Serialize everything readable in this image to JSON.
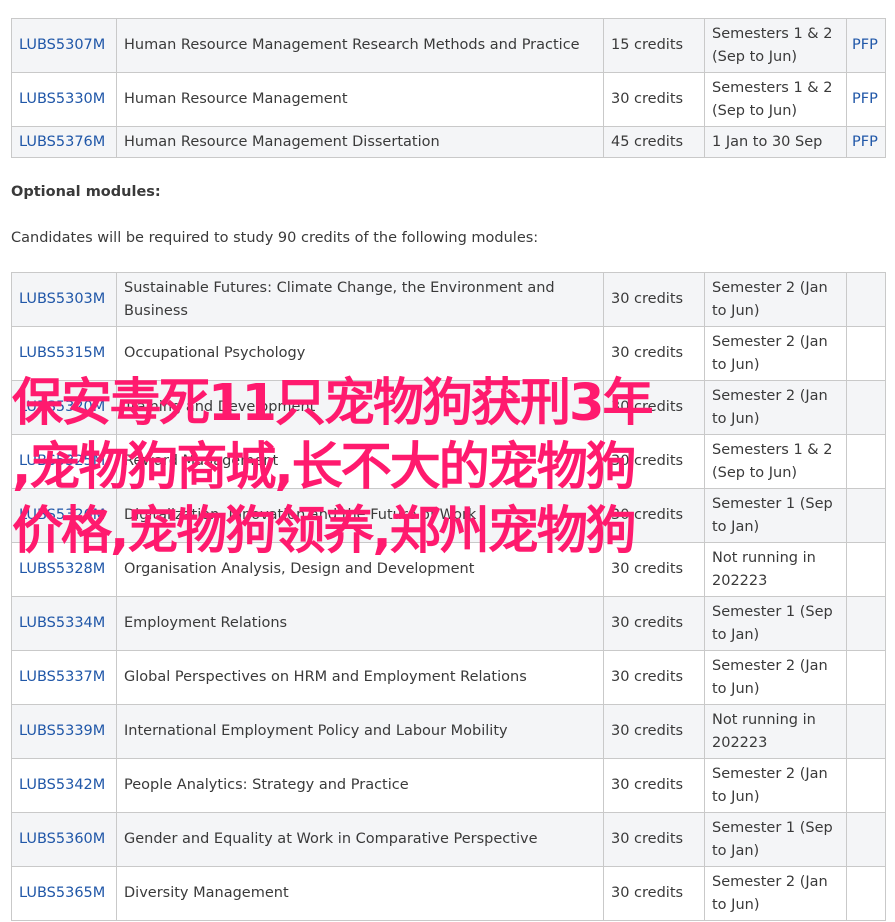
{
  "core_modules": [
    {
      "code": "LUBS5307M",
      "title": "Human Resource Management Research Methods and Practice",
      "credits": "15 credits",
      "running": "Semesters 1 & 2 (Sep to Jun)",
      "pfp": "PFP"
    },
    {
      "code": "LUBS5330M",
      "title": "Human Resource Management",
      "credits": "30 credits",
      "running": "Semesters 1 & 2 (Sep to Jun)",
      "pfp": "PFP"
    },
    {
      "code": "LUBS5376M",
      "title": "Human Resource Management Dissertation",
      "credits": "45 credits",
      "running": "1 Jan to 30 Sep",
      "pfp": "PFP"
    }
  ],
  "optional_section": {
    "heading": "Optional modules:",
    "intro": "Candidates will be required to study 90 credits of the following modules:"
  },
  "optional_modules": [
    {
      "code": "LUBS5303M",
      "title": "Sustainable Futures: Climate Change, the Environment and Business",
      "credits": "30 credits",
      "running": "Semester 2 (Jan to Jun)"
    },
    {
      "code": "LUBS5315M",
      "title": "Occupational Psychology",
      "credits": "30 credits",
      "running": "Semester 2 (Jan to Jun)"
    },
    {
      "code": "LUBS5320M",
      "title": "Training and Development",
      "credits": "30 credits",
      "running": "Semester 2 (Jan to Jun)"
    },
    {
      "code": "LUBS5325M",
      "title": "Reward Management",
      "credits": "30 credits",
      "running": "Semesters 1 & 2 (Sep to Jun)"
    },
    {
      "code": "LUBS5326M",
      "title": "Digitalization, Innovation and the Future of Work",
      "credits": "30 credits",
      "running": "Semester 1 (Sep to Jan)"
    },
    {
      "code": "LUBS5328M",
      "title": "Organisation Analysis, Design and Development",
      "credits": "30 credits",
      "running": "Not running in 202223"
    },
    {
      "code": "LUBS5334M",
      "title": "Employment Relations",
      "credits": "30 credits",
      "running": "Semester 1 (Sep to Jan)"
    },
    {
      "code": "LUBS5337M",
      "title": "Global Perspectives on HRM and Employment Relations",
      "credits": "30 credits",
      "running": "Semester 2 (Jan to Jun)"
    },
    {
      "code": "LUBS5339M",
      "title": "International Employment Policy and Labour Mobility",
      "credits": "30 credits",
      "running": "Not running in 202223"
    },
    {
      "code": "LUBS5342M",
      "title": "People Analytics: Strategy and Practice",
      "credits": "30 credits",
      "running": "Semester 2 (Jan to Jun)"
    },
    {
      "code": "LUBS5360M",
      "title": "Gender and Equality at Work in Comparative Perspective",
      "credits": "30 credits",
      "running": "Semester 1 (Sep to Jan)"
    },
    {
      "code": "LUBS5365M",
      "title": "Diversity Management",
      "credits": "30 credits",
      "running": "Semester 2 (Jan to Jun)"
    }
  ],
  "overlay": {
    "line1": "保安毒死11只宠物狗获刑3年",
    "line2": ",宠物狗商城,长不大的宠物狗",
    "line3": "价格,宠物狗领养,郑州宠物狗"
  },
  "colors": {
    "link": "#2057a8",
    "overlay_text": "#ff1a6e",
    "row_shade": "#f4f5f7",
    "border": "#c9c9c9"
  }
}
